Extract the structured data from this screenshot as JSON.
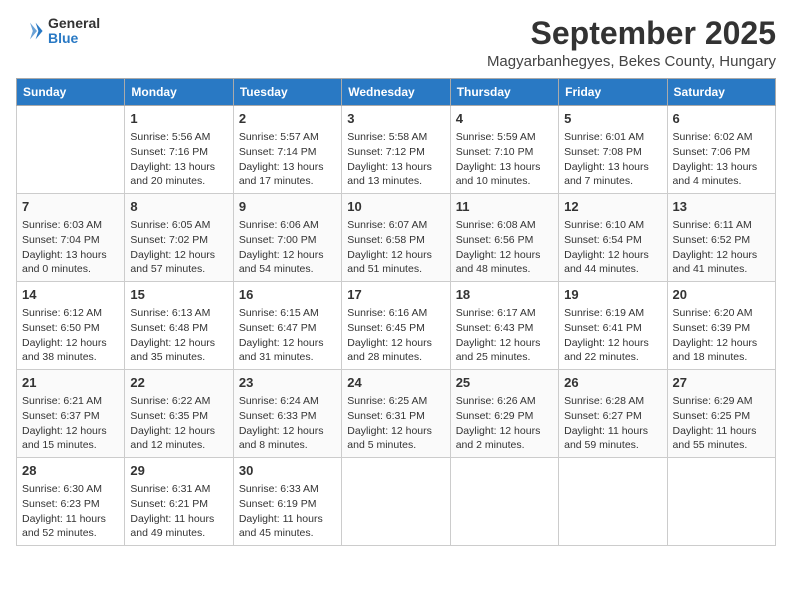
{
  "header": {
    "logo_general": "General",
    "logo_blue": "Blue",
    "month": "September 2025",
    "location": "Magyarbanhegyes, Bekes County, Hungary"
  },
  "days_of_week": [
    "Sunday",
    "Monday",
    "Tuesday",
    "Wednesday",
    "Thursday",
    "Friday",
    "Saturday"
  ],
  "weeks": [
    [
      {
        "day": "",
        "text": ""
      },
      {
        "day": "1",
        "text": "Sunrise: 5:56 AM\nSunset: 7:16 PM\nDaylight: 13 hours\nand 20 minutes."
      },
      {
        "day": "2",
        "text": "Sunrise: 5:57 AM\nSunset: 7:14 PM\nDaylight: 13 hours\nand 17 minutes."
      },
      {
        "day": "3",
        "text": "Sunrise: 5:58 AM\nSunset: 7:12 PM\nDaylight: 13 hours\nand 13 minutes."
      },
      {
        "day": "4",
        "text": "Sunrise: 5:59 AM\nSunset: 7:10 PM\nDaylight: 13 hours\nand 10 minutes."
      },
      {
        "day": "5",
        "text": "Sunrise: 6:01 AM\nSunset: 7:08 PM\nDaylight: 13 hours\nand 7 minutes."
      },
      {
        "day": "6",
        "text": "Sunrise: 6:02 AM\nSunset: 7:06 PM\nDaylight: 13 hours\nand 4 minutes."
      }
    ],
    [
      {
        "day": "7",
        "text": "Sunrise: 6:03 AM\nSunset: 7:04 PM\nDaylight: 13 hours\nand 0 minutes."
      },
      {
        "day": "8",
        "text": "Sunrise: 6:05 AM\nSunset: 7:02 PM\nDaylight: 12 hours\nand 57 minutes."
      },
      {
        "day": "9",
        "text": "Sunrise: 6:06 AM\nSunset: 7:00 PM\nDaylight: 12 hours\nand 54 minutes."
      },
      {
        "day": "10",
        "text": "Sunrise: 6:07 AM\nSunset: 6:58 PM\nDaylight: 12 hours\nand 51 minutes."
      },
      {
        "day": "11",
        "text": "Sunrise: 6:08 AM\nSunset: 6:56 PM\nDaylight: 12 hours\nand 48 minutes."
      },
      {
        "day": "12",
        "text": "Sunrise: 6:10 AM\nSunset: 6:54 PM\nDaylight: 12 hours\nand 44 minutes."
      },
      {
        "day": "13",
        "text": "Sunrise: 6:11 AM\nSunset: 6:52 PM\nDaylight: 12 hours\nand 41 minutes."
      }
    ],
    [
      {
        "day": "14",
        "text": "Sunrise: 6:12 AM\nSunset: 6:50 PM\nDaylight: 12 hours\nand 38 minutes."
      },
      {
        "day": "15",
        "text": "Sunrise: 6:13 AM\nSunset: 6:48 PM\nDaylight: 12 hours\nand 35 minutes."
      },
      {
        "day": "16",
        "text": "Sunrise: 6:15 AM\nSunset: 6:47 PM\nDaylight: 12 hours\nand 31 minutes."
      },
      {
        "day": "17",
        "text": "Sunrise: 6:16 AM\nSunset: 6:45 PM\nDaylight: 12 hours\nand 28 minutes."
      },
      {
        "day": "18",
        "text": "Sunrise: 6:17 AM\nSunset: 6:43 PM\nDaylight: 12 hours\nand 25 minutes."
      },
      {
        "day": "19",
        "text": "Sunrise: 6:19 AM\nSunset: 6:41 PM\nDaylight: 12 hours\nand 22 minutes."
      },
      {
        "day": "20",
        "text": "Sunrise: 6:20 AM\nSunset: 6:39 PM\nDaylight: 12 hours\nand 18 minutes."
      }
    ],
    [
      {
        "day": "21",
        "text": "Sunrise: 6:21 AM\nSunset: 6:37 PM\nDaylight: 12 hours\nand 15 minutes."
      },
      {
        "day": "22",
        "text": "Sunrise: 6:22 AM\nSunset: 6:35 PM\nDaylight: 12 hours\nand 12 minutes."
      },
      {
        "day": "23",
        "text": "Sunrise: 6:24 AM\nSunset: 6:33 PM\nDaylight: 12 hours\nand 8 minutes."
      },
      {
        "day": "24",
        "text": "Sunrise: 6:25 AM\nSunset: 6:31 PM\nDaylight: 12 hours\nand 5 minutes."
      },
      {
        "day": "25",
        "text": "Sunrise: 6:26 AM\nSunset: 6:29 PM\nDaylight: 12 hours\nand 2 minutes."
      },
      {
        "day": "26",
        "text": "Sunrise: 6:28 AM\nSunset: 6:27 PM\nDaylight: 11 hours\nand 59 minutes."
      },
      {
        "day": "27",
        "text": "Sunrise: 6:29 AM\nSunset: 6:25 PM\nDaylight: 11 hours\nand 55 minutes."
      }
    ],
    [
      {
        "day": "28",
        "text": "Sunrise: 6:30 AM\nSunset: 6:23 PM\nDaylight: 11 hours\nand 52 minutes."
      },
      {
        "day": "29",
        "text": "Sunrise: 6:31 AM\nSunset: 6:21 PM\nDaylight: 11 hours\nand 49 minutes."
      },
      {
        "day": "30",
        "text": "Sunrise: 6:33 AM\nSunset: 6:19 PM\nDaylight: 11 hours\nand 45 minutes."
      },
      {
        "day": "",
        "text": ""
      },
      {
        "day": "",
        "text": ""
      },
      {
        "day": "",
        "text": ""
      },
      {
        "day": "",
        "text": ""
      }
    ]
  ]
}
